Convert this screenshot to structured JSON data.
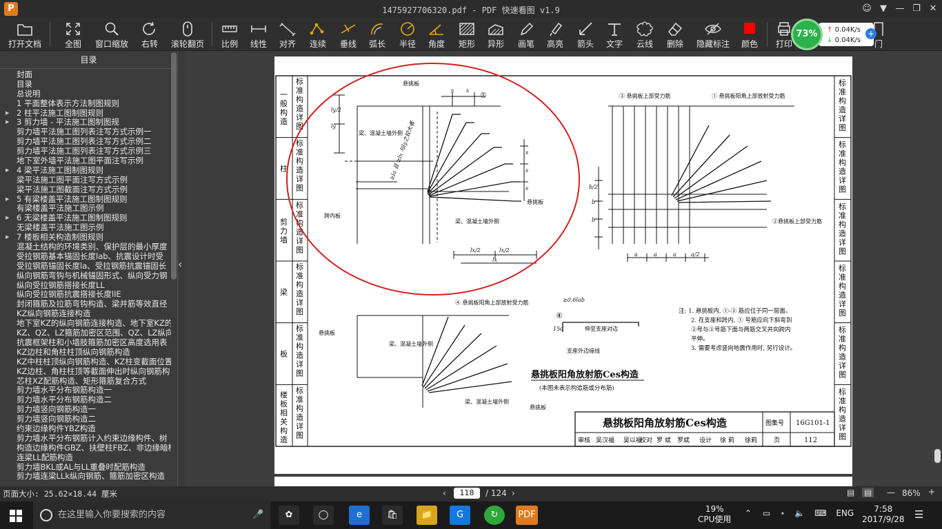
{
  "window": {
    "title": "1475927706320.pdf - PDF 快速看图 v1.9",
    "app_logo": "P"
  },
  "toolbar": {
    "items": [
      {
        "label": "打开文档",
        "icon": "folder-icon"
      },
      {
        "label": "全图",
        "icon": "fullscreen-icon"
      },
      {
        "label": "窗口缩放",
        "icon": "zoom-icon"
      },
      {
        "label": "右转",
        "icon": "rotate-icon"
      },
      {
        "label": "滚轮翻页",
        "icon": "mouse-icon"
      },
      {
        "label": "比例",
        "icon": "scale-icon"
      },
      {
        "label": "线性",
        "icon": "linear-icon"
      },
      {
        "label": "对齐",
        "icon": "align-icon"
      },
      {
        "label": "连续",
        "icon": "continuous-icon"
      },
      {
        "label": "垂线",
        "icon": "perpendicular-icon"
      },
      {
        "label": "弧长",
        "icon": "arc-length-icon"
      },
      {
        "label": "半径",
        "icon": "radius-icon"
      },
      {
        "label": "角度",
        "icon": "angle-icon"
      },
      {
        "label": "矩形",
        "icon": "rectangle-icon"
      },
      {
        "label": "异形",
        "icon": "irregular-icon"
      },
      {
        "label": "画笔",
        "icon": "pen-icon"
      },
      {
        "label": "高亮",
        "icon": "highlight-icon"
      },
      {
        "label": "箭头",
        "icon": "arrow-icon"
      },
      {
        "label": "文字",
        "icon": "text-icon"
      },
      {
        "label": "云线",
        "icon": "cloud-icon"
      },
      {
        "label": "删除",
        "icon": "eraser-icon"
      },
      {
        "label": "隐藏标注",
        "icon": "hide-icon"
      },
      {
        "label": "颜色",
        "icon": "color-icon"
      },
      {
        "label": "打印",
        "icon": "print-icon"
      },
      {
        "label": "门",
        "icon": "door-icon"
      }
    ],
    "color_swatch": "#ff0000"
  },
  "net_widget": {
    "percent": "73%",
    "upload": "0.04K/s",
    "download": "0.04K/s"
  },
  "sidebar": {
    "title": "目录",
    "items": [
      {
        "label": "封面",
        "arrow": false
      },
      {
        "label": "目录",
        "arrow": false
      },
      {
        "label": "总说明",
        "arrow": false
      },
      {
        "label": "1 平面整体表示方法制图规则",
        "arrow": false
      },
      {
        "label": "2 柱平法施工图制图规则",
        "arrow": true
      },
      {
        "label": "3 剪力墙 - 平法施工图制图规",
        "arrow": true
      },
      {
        "label": "剪力墙平法施工图列表注写方式示例一",
        "arrow": false
      },
      {
        "label": "剪力墙平法施工图列表注写方式示例二",
        "arrow": false
      },
      {
        "label": "剪力墙平法施工图列表注写方式示例三",
        "arrow": false
      },
      {
        "label": "地下室外墙平法施工图平面注写示例",
        "arrow": false
      },
      {
        "label": "4 梁平法施工图制图规则",
        "arrow": true
      },
      {
        "label": "梁平法施工图平面注写方式示例",
        "arrow": false
      },
      {
        "label": "梁平法施工图截面注写方式示例",
        "arrow": false
      },
      {
        "label": "5 有梁楼盖平法施工图制图规则",
        "arrow": true
      },
      {
        "label": "有梁楼盖平法施工图示例",
        "arrow": false
      },
      {
        "label": "6 无梁楼盖平法施工图制图规则",
        "arrow": true
      },
      {
        "label": "无梁楼盖平法施工图示例",
        "arrow": false
      },
      {
        "label": "7 楼板相关构造制图规则",
        "arrow": true
      },
      {
        "label": "混凝土结构的环境类别、保护层的最小厚度",
        "arrow": false
      },
      {
        "label": "受拉钢筋基本锚固长度lab、抗震设计时受",
        "arrow": false
      },
      {
        "label": "受拉钢筋锚固长度la、受拉钢筋抗震锚固长",
        "arrow": false
      },
      {
        "label": "纵向钢筋弯钩与机械锚固形式、纵向受力钢",
        "arrow": false
      },
      {
        "label": "纵向受拉钢筋搭接长度LL",
        "arrow": false
      },
      {
        "label": "纵向受拉钢筋抗震搭接长度llE",
        "arrow": false
      },
      {
        "label": "封闭箍筋及拉筋弯钩构造、梁并筋等效直径",
        "arrow": false
      },
      {
        "label": "KZ纵向钢筋连接构造",
        "arrow": false
      },
      {
        "label": "地下室KZ的纵向钢筋连接构造、地下室KZ的",
        "arrow": false
      },
      {
        "label": "KZ、QZ、LZ箍筋加密区范围、QZ、LZ纵向钢筋",
        "arrow": false
      },
      {
        "label": "抗震框架柱和小墙肢箍筋加密区高度选用表",
        "arrow": false
      },
      {
        "label": "KZ边柱和角柱柱顶纵向钢筋构造",
        "arrow": false
      },
      {
        "label": "KZ中柱柱顶纵向钢筋构造、KZ柱变截面位置",
        "arrow": false
      },
      {
        "label": "KZ边柱、角柱柱顶等截面伸出时纵向钢筋构",
        "arrow": false
      },
      {
        "label": "芯柱XZ配筋构造、矩形箍筋复合方式",
        "arrow": false
      },
      {
        "label": "剪力墙水平分布钢筋构造一",
        "arrow": false
      },
      {
        "label": "剪力墙水平分布钢筋构造二",
        "arrow": false
      },
      {
        "label": "剪力墙竖向钢筋构造一",
        "arrow": false
      },
      {
        "label": "剪力墙竖向钢筋构造二",
        "arrow": false
      },
      {
        "label": "约束边缘构件YBZ构造",
        "arrow": false
      },
      {
        "label": "剪力墙水平分布钢筋计入约束边缘构件、树",
        "arrow": false
      },
      {
        "label": "构造边缘构件GBZ、扶壁柱FBZ、非边缘暗柱",
        "arrow": false
      },
      {
        "label": "连梁LL配筋构造",
        "arrow": false
      },
      {
        "label": "剪力墙BKL或AL与LL重叠时配筋构造",
        "arrow": false
      },
      {
        "label": "剪力墙连梁LLk纵向钢筋、箍筋加密区构造",
        "arrow": false
      }
    ]
  },
  "drawing": {
    "side_tabs_left": [
      {
        "category": "一般构造",
        "tab": "标准构造详图"
      },
      {
        "category": "柱",
        "tab": "标准构造详图"
      },
      {
        "category": "剪力墙",
        "tab": "标准构造详图"
      },
      {
        "category": "梁",
        "tab": "标准构造详图"
      },
      {
        "category": "板",
        "tab": "标准构造详图"
      },
      {
        "category": "楼板相关构造",
        "tab": "标准构造详图"
      }
    ],
    "right_tab": "标准构造详图",
    "labels": {
      "cantilever": "悬挑板",
      "beam_outer": "梁、混凝土墙外侧",
      "span_slab": "跨内板",
      "bar1": "①",
      "bar2_label": "②悬挑板上部受力筋",
      "bar3_label": "③ 悬挑板上部受力筋",
      "bar1_label": "① 悬挑板阳角上部放射受力筋",
      "bar4_label": "④ 悬挑板阳角上部放射受力筋",
      "anchor": "≥0.6lab",
      "extend_support": "伸至支座对边",
      "support_line": "支座外边缘线",
      "s": "s",
      "a": "a",
      "b": "b",
      "a2": "a/2",
      "b2": "b/2",
      "l2": "lx/2",
      "lx": "lx",
      "ly": "ly",
      "ly2": "ly/2",
      "dim15d": "15d",
      "diag": "≥la 且 ≥lx 与ly之较大者",
      "bar4": "④"
    },
    "notes": [
      "注: 1. 悬挑板内, ①-③ 筋应位于同一层面。",
      "2. 在支座和跨内, ① 号筋应向下斜弯到",
      "②号与③号筋下面与两筋交叉并向跨内",
      "平伸。",
      "3. 需要考虑竖向地震作用时, 另行设计。"
    ],
    "section_title": "悬挑板阳角放射筋Ces构造",
    "section_subtitle": "(本图未表示构造筋或分布筋)",
    "title_block": {
      "title": "悬挑板阳角放射筋Ces构造",
      "atlas_label": "图集号",
      "atlas_no": "16G101-1",
      "page_label": "页",
      "page_no": "112",
      "row": [
        "审核",
        "吴汉福",
        "吴以福",
        "校对",
        "罗 斌",
        "罗斌",
        "设计",
        "徐 莉",
        "徐莉"
      ]
    }
  },
  "status": {
    "page_size": "页面大小: 25.62×18.44 厘米",
    "current_page": "118",
    "total_pages": "/ 124",
    "zoom": "86%"
  },
  "taskbar": {
    "search_placeholder": "在这里输入你要搜索的内容",
    "cpu_percent": "19%",
    "cpu_label": "CPU使用",
    "lang": "ENG",
    "time": "7:58",
    "date": "2017/9/28"
  }
}
